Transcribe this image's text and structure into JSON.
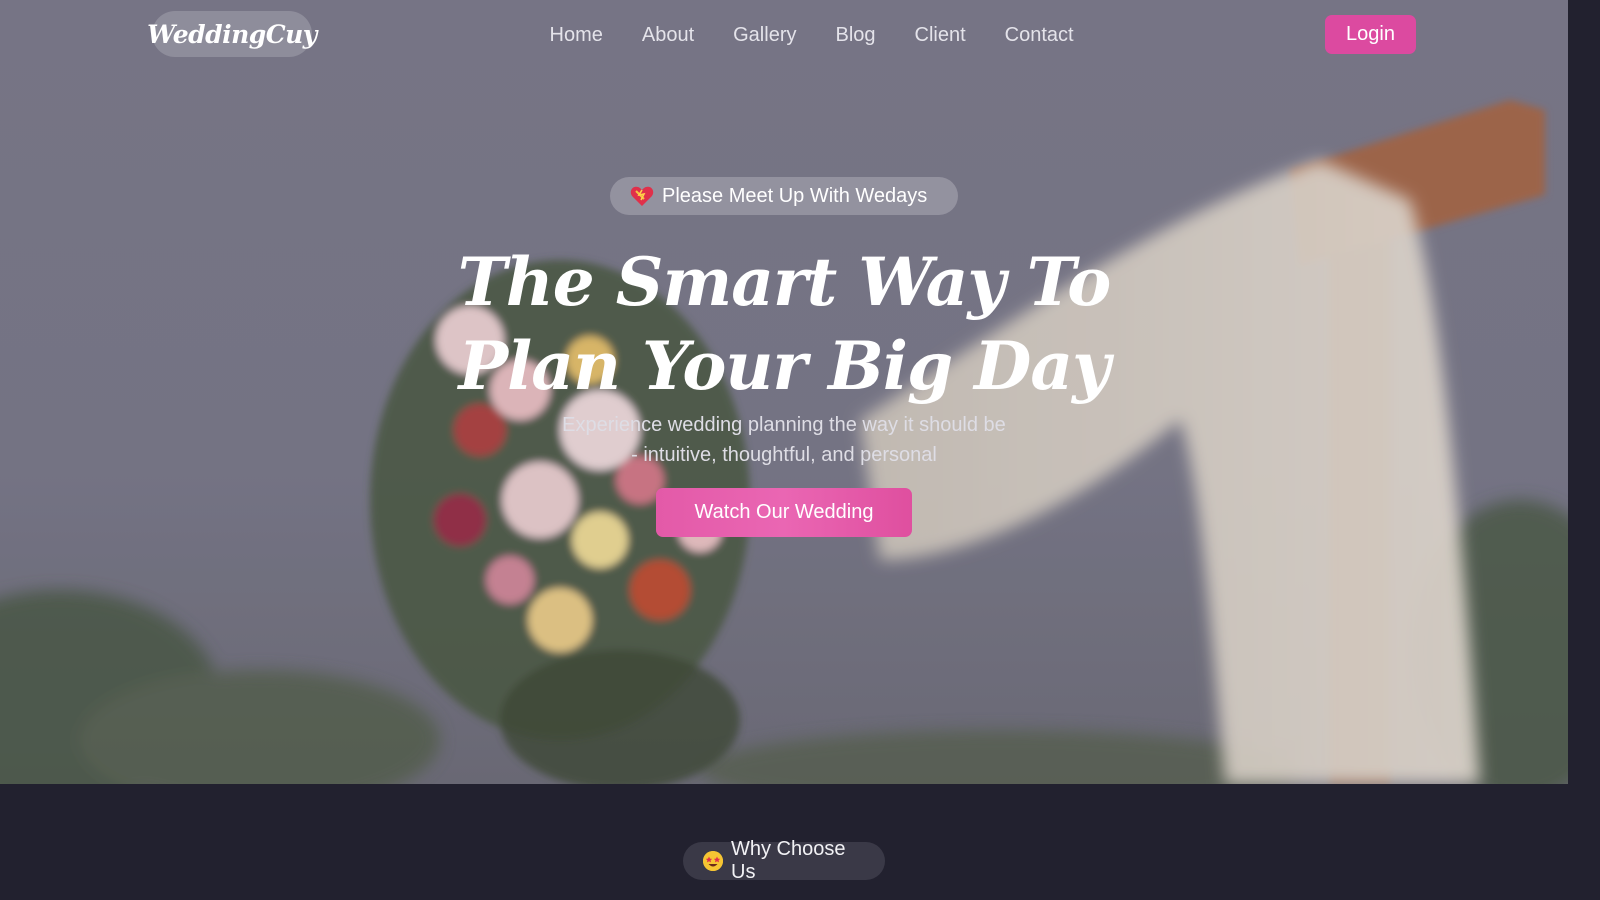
{
  "brand": {
    "logo_text": "WeddingCuy"
  },
  "nav": {
    "links": [
      "Home",
      "About",
      "Gallery",
      "Blog",
      "Client",
      "Contact"
    ],
    "login_label": "Login"
  },
  "hero": {
    "badge": "Please Meet Up With Wedays",
    "badge_icon": "heart-icon",
    "title_line1": "The Smart Way To",
    "title_line2": "Plan Your Big Day",
    "subtitle_line1": "Experience wedding planning the way it should be",
    "subtitle_line2": "- intuitive, thoughtful, and personal",
    "cta_label": "Watch Our Wedding"
  },
  "section": {
    "badge": "Why Choose Us",
    "badge_icon": "star-struck-emoji-icon"
  },
  "colors": {
    "accent": "#dc4aa0",
    "dark_bg": "#22212f"
  }
}
